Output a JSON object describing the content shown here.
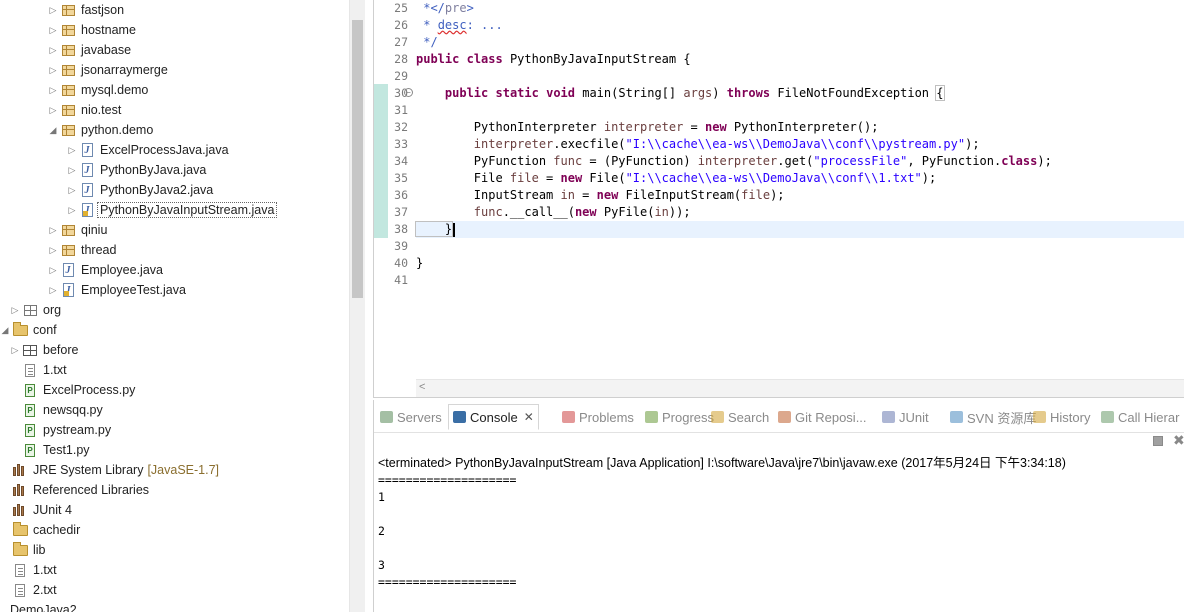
{
  "explorer": {
    "items": [
      {
        "label": "fastjson",
        "icon": "package-icon",
        "twisty": "collapsed"
      },
      {
        "label": "hostname",
        "icon": "package-icon",
        "twisty": "collapsed"
      },
      {
        "label": "javabase",
        "icon": "package-icon",
        "twisty": "collapsed"
      },
      {
        "label": "jsonarraymerge",
        "icon": "package-icon",
        "twisty": "collapsed"
      },
      {
        "label": "mysql.demo",
        "icon": "package-icon",
        "twisty": "collapsed"
      },
      {
        "label": "nio.test",
        "icon": "package-icon",
        "twisty": "collapsed"
      },
      {
        "label": "python.demo",
        "icon": "package-icon",
        "twisty": "expanded"
      },
      {
        "label": "ExcelProcessJava.java",
        "icon": "java-file-icon",
        "twisty": "collapsed"
      },
      {
        "label": "PythonByJava.java",
        "icon": "java-file-icon",
        "twisty": "collapsed"
      },
      {
        "label": "PythonByJava2.java",
        "icon": "java-file-icon",
        "twisty": "collapsed"
      },
      {
        "label": "PythonByJavaInputStream.java",
        "icon": "java-file-warning-icon",
        "twisty": "collapsed",
        "selected": true
      },
      {
        "label": "qiniu",
        "icon": "package-icon",
        "twisty": "collapsed"
      },
      {
        "label": "thread",
        "icon": "package-icon",
        "twisty": "collapsed"
      },
      {
        "label": "Employee.java",
        "icon": "java-file-icon",
        "twisty": "collapsed"
      },
      {
        "label": "EmployeeTest.java",
        "icon": "java-file-warning-icon",
        "twisty": "collapsed"
      },
      {
        "label": "org",
        "icon": "empty-package-icon",
        "twisty": "collapsed"
      },
      {
        "label": "conf",
        "icon": "folder-icon",
        "twisty": "expanded"
      },
      {
        "label": "before",
        "icon": "source-folder-icon",
        "twisty": "collapsed"
      },
      {
        "label": "1.txt",
        "icon": "text-file-icon",
        "twisty": ""
      },
      {
        "label": "ExcelProcess.py",
        "icon": "python-file-icon",
        "twisty": ""
      },
      {
        "label": "newsqq.py",
        "icon": "python-file-icon",
        "twisty": ""
      },
      {
        "label": "pystream.py",
        "icon": "python-file-icon",
        "twisty": ""
      },
      {
        "label": "Test1.py",
        "icon": "python-file-icon",
        "twisty": ""
      },
      {
        "label": "JRE System Library",
        "suffix": "[JavaSE-1.7]",
        "icon": "library-icon",
        "twisty": ""
      },
      {
        "label": "Referenced Libraries",
        "icon": "library-icon",
        "twisty": ""
      },
      {
        "label": "JUnit 4",
        "icon": "library-icon",
        "twisty": ""
      },
      {
        "label": "cachedir",
        "icon": "folder-icon",
        "twisty": ""
      },
      {
        "label": "lib",
        "icon": "folder-icon",
        "twisty": ""
      },
      {
        "label": "1.txt",
        "icon": "text-file-icon",
        "twisty": ""
      },
      {
        "label": "2.txt",
        "icon": "text-file-icon",
        "twisty": ""
      },
      {
        "label": "DemoJava2",
        "icon": "",
        "twisty": ""
      }
    ]
  },
  "editor": {
    "line_numbers": [
      "25",
      "26",
      "27",
      "28",
      "29",
      "30",
      "31",
      "32",
      "33",
      "34",
      "35",
      "36",
      "37",
      "38",
      "39",
      "40",
      "41"
    ],
    "code": {
      "l25_text": " */pre>",
      "l26_star": " * ",
      "l26_word": "desc",
      "l26_rest": ": ...",
      "l27": " */",
      "l28_kw1": "public",
      "l28_kw2": "class",
      "l28_rest": " PythonByJavaInputStream {",
      "l30_indent": "    ",
      "l30_kw1": "public",
      "l30_kw2": "static",
      "l30_kw3": "void",
      "l30_mid": " main(String[] ",
      "l30_args": "args",
      "l30_throws": "throws",
      "l30_rest": " FileNotFoundException ",
      "l30_brace": "{",
      "l32_a": "        PythonInterpreter ",
      "l32_var": "interpreter",
      "l32_b": " = ",
      "l32_new": "new",
      "l32_c": " PythonInterpreter();",
      "l33_a": "        ",
      "l33_var": "interpreter",
      "l33_b": ".execfile(",
      "l33_str": "\"I:\\\\cache\\\\ea-ws\\\\DemoJava\\\\conf\\\\pystream.py\"",
      "l33_c": ");",
      "l34_a": "        PyFunction ",
      "l34_var": "func",
      "l34_b": " = (PyFunction) ",
      "l34_var2": "interpreter",
      "l34_c": ".get(",
      "l34_str": "\"processFile\"",
      "l34_d": ", PyFunction.",
      "l34_kw": "class",
      "l34_e": ");",
      "l35_a": "        File ",
      "l35_var": "file",
      "l35_b": " = ",
      "l35_new": "new",
      "l35_c": " File(",
      "l35_str": "\"I:\\\\cache\\\\ea-ws\\\\DemoJava\\\\conf\\\\1.txt\"",
      "l35_d": ");",
      "l36_a": "        InputStream ",
      "l36_var": "in",
      "l36_b": " = ",
      "l36_new": "new",
      "l36_c": " FileInputStream(",
      "l36_var2": "file",
      "l36_d": ");",
      "l37_a": "        ",
      "l37_var": "func",
      "l37_b": ".__call__(",
      "l37_new": "new",
      "l37_c": " PyFile(",
      "l37_var2": "in",
      "l37_d": "));",
      "l38": "    }",
      "l40": "}"
    }
  },
  "console": {
    "tabs": [
      {
        "label": "Servers",
        "icon": "servers-icon",
        "color": "#5a8a5a"
      },
      {
        "label": "Console",
        "icon": "console-icon",
        "color": "#3a6ea5",
        "active": true
      },
      {
        "label": "Problems",
        "icon": "problems-icon",
        "color": "#c44"
      },
      {
        "label": "Progress",
        "icon": "progress-icon",
        "color": "#6a9a3a"
      },
      {
        "label": "Search",
        "icon": "search-icon",
        "color": "#d0a030"
      },
      {
        "label": "Git Reposi...",
        "icon": "git-icon",
        "color": "#c06030"
      },
      {
        "label": "JUnit",
        "icon": "junit-icon",
        "color": "#6a7ab0"
      },
      {
        "label": "SVN 资源库",
        "icon": "svn-icon",
        "color": "#4a8ac0"
      },
      {
        "label": "History",
        "icon": "history-icon",
        "color": "#d0a030"
      },
      {
        "label": "Call Hierar",
        "icon": "call-hierarchy-icon",
        "color": "#6a9a6a"
      }
    ],
    "status": "<terminated> PythonByJavaInputStream [Java Application] I:\\software\\Java\\jre7\\bin\\javaw.exe (2017年5月24日 下午3:34:18)",
    "output": [
      "====================",
      "1",
      "",
      "2",
      "",
      "3",
      "===================="
    ]
  },
  "colors": {
    "keyword": "#7f0055",
    "string": "#2a00ff",
    "comment": "#3f5fbf",
    "current_line": "#e8f2fe"
  }
}
